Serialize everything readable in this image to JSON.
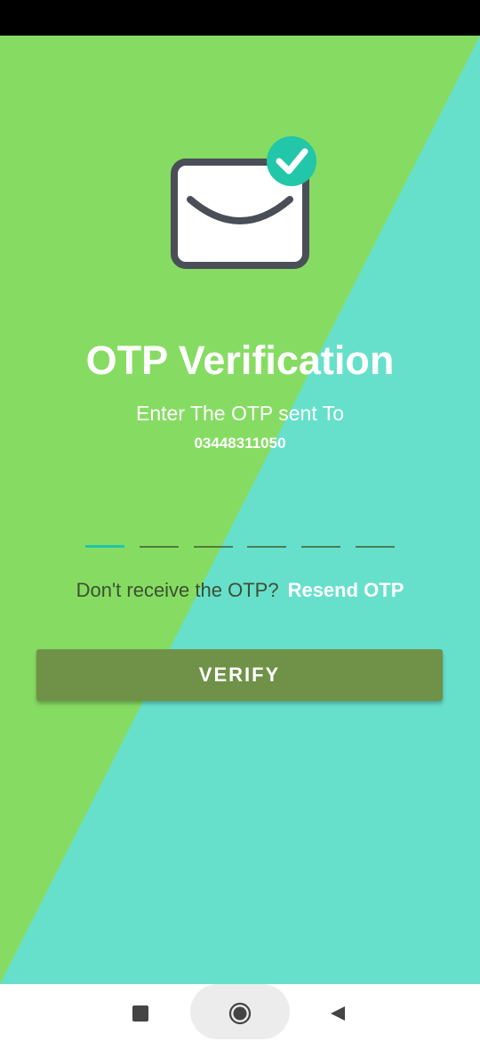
{
  "colors": {
    "background_green": "#86DC62",
    "background_teal": "#66E0CB",
    "accent_teal": "#22C6A8",
    "button_olive": "#6F9248",
    "text_white": "#FFFFFF",
    "prompt_dark": "#3C4F33"
  },
  "hero": {
    "icon": "envelope-check-icon"
  },
  "header": {
    "title": "OTP Verification",
    "subtitle": "Enter The OTP sent To",
    "phone_number": "03448311050"
  },
  "otp": {
    "digit_count": 6,
    "values": [
      "",
      "",
      "",
      "",
      "",
      ""
    ],
    "active_index": 0
  },
  "resend": {
    "prompt": "Don't receive the OTP?",
    "link_label": "Resend OTP"
  },
  "verify_button": {
    "label": "VERIFY"
  },
  "navigation": {
    "recents_icon": "square-recents-icon",
    "home_icon": "circle-home-icon",
    "back_icon": "triangle-back-icon"
  }
}
